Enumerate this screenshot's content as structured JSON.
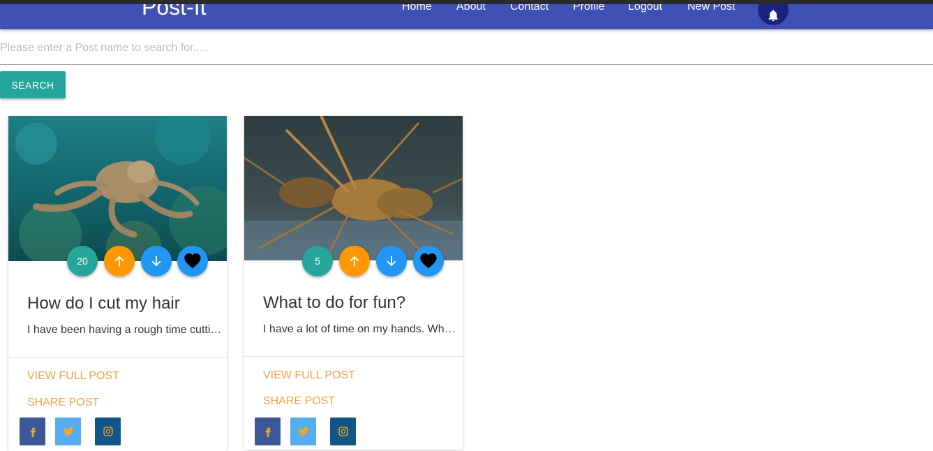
{
  "navbar": {
    "brand": "Post-It",
    "links": [
      "Home",
      "About",
      "Contact",
      "Profile",
      "Logout",
      "New Post"
    ],
    "bell_icon": "bell-icon",
    "color": "#3f51b5"
  },
  "search": {
    "placeholder": "Please enter a Post name to search for.....",
    "value": "",
    "button_label": "SEARCH",
    "button_color": "#26a69a"
  },
  "posts": [
    {
      "image": "octopus-photo",
      "votes": "20",
      "title": "How do I cut my hair",
      "excerpt": "I have been having a rough time cutting my hair",
      "view_label": "VIEW FULL POST",
      "share_label": "SHARE POST"
    },
    {
      "image": "lobster-photo",
      "votes": "5",
      "title": "What to do for fun?",
      "excerpt": "I have a lot of time on my hands. What should I do",
      "view_label": "VIEW FULL POST",
      "share_label": "SHARE POST"
    }
  ],
  "icons": {
    "upvote": "arrow-up-icon",
    "downvote": "arrow-down-icon",
    "like": "heart-icon",
    "social": [
      "facebook-icon",
      "twitter-icon",
      "instagram-icon"
    ]
  },
  "colors": {
    "accent_link": "#f4a04a",
    "vote_count": "#26a69a",
    "upvote": "#ff9800",
    "downvote": "#2196f3",
    "facebook": "#3b5998",
    "twitter": "#55acee",
    "instagram": "#125688"
  }
}
